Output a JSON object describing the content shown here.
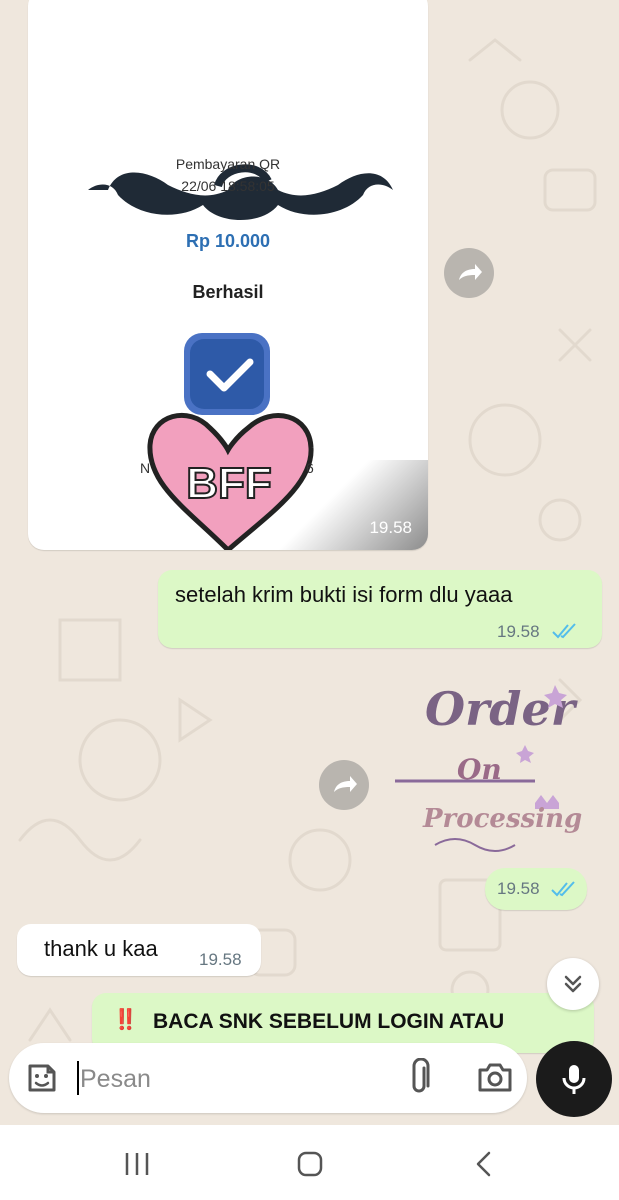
{
  "chat": {
    "image_message": {
      "receipt_title": "Pembayaran QR",
      "receipt_datetime": "22/06 18:58:05",
      "receipt_amount": "Rp 10.000",
      "receipt_status": "Berhasil",
      "receipt_partial_left": "N",
      "receipt_partial_right": "6",
      "sticker_text": "BFF",
      "time": "19.58"
    },
    "outgoing_message_1": {
      "text": "setelah krim bukti isi form dlu yaaa",
      "time": "19.58",
      "status": "read"
    },
    "sticker_message": {
      "line1": "Order",
      "line2": "On",
      "line3": "Processing",
      "time": "19.58",
      "status": "read"
    },
    "incoming_message_1": {
      "text": "thank u kaa",
      "time": "19.58"
    },
    "pinned_banner": {
      "emoji": "‼️",
      "text": "BACA SNK SEBELUM LOGIN ATAU"
    }
  },
  "input_bar": {
    "placeholder": "Pesan",
    "icons": [
      "sticker-icon",
      "attach-icon",
      "camera-icon",
      "mic-icon"
    ]
  },
  "nav_bar": {
    "icons": [
      "recents-icon",
      "home-icon",
      "back-icon"
    ]
  },
  "colors": {
    "chat_background": "#efe7dd",
    "outgoing_bubble": "#dcf8c6",
    "incoming_bubble": "#ffffff",
    "read_ticks": "#53bdeb",
    "amount_blue": "#2d6fb3"
  }
}
